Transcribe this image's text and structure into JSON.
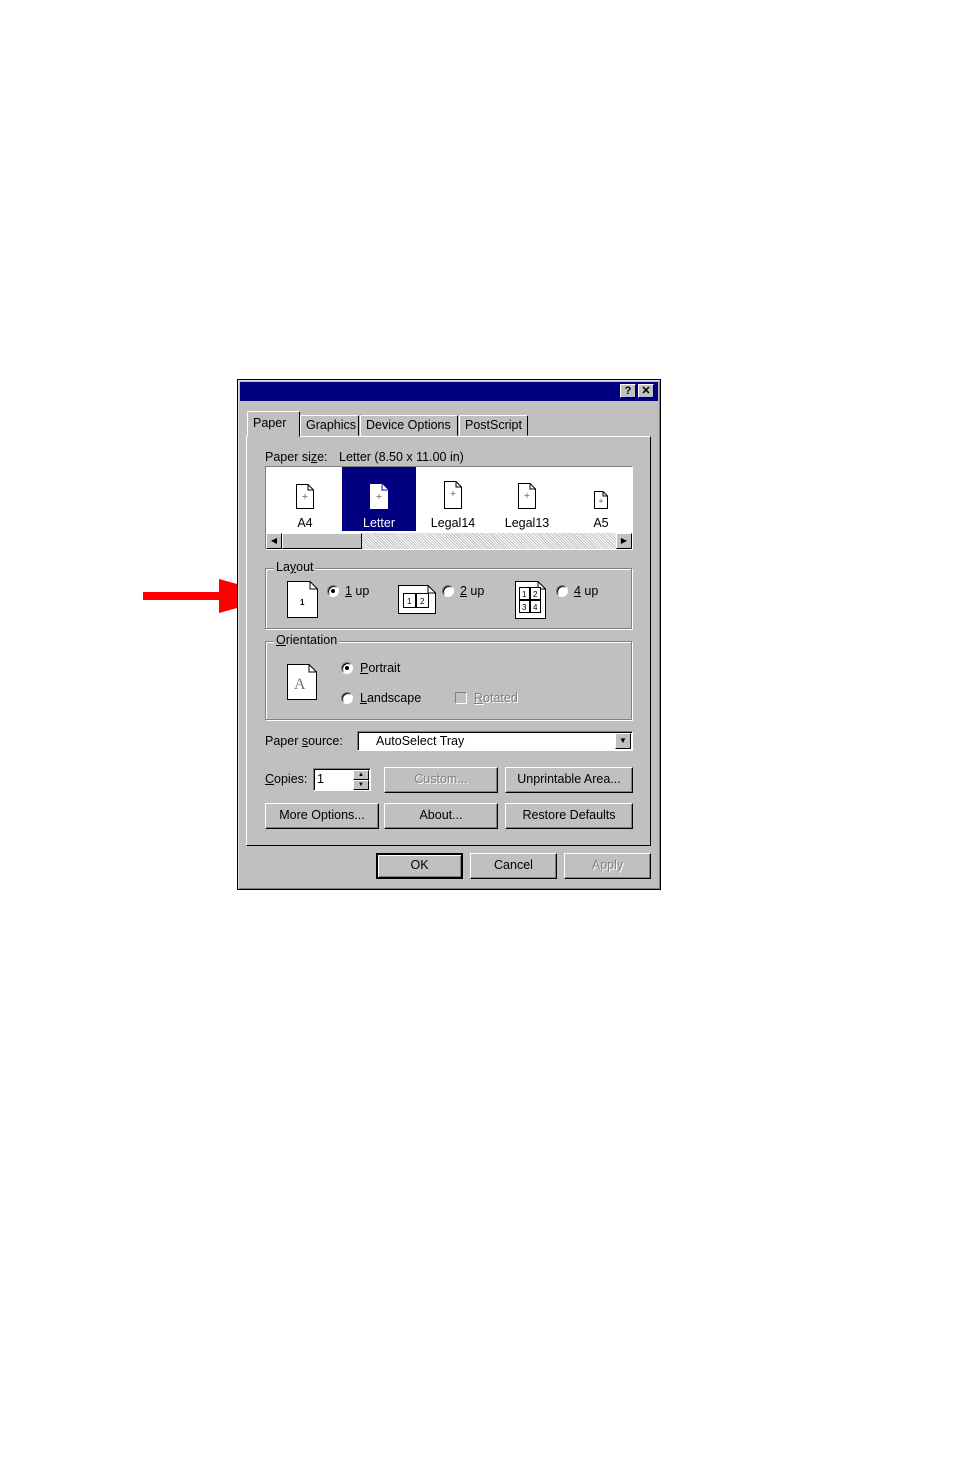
{
  "dialog": {
    "help_button": "?",
    "close_button": "✕",
    "tabs": [
      {
        "label": "Paper",
        "active": true
      },
      {
        "label": "Graphics",
        "active": false
      },
      {
        "label": "Device Options",
        "active": false
      },
      {
        "label": "PostScript",
        "active": false
      }
    ],
    "paper_size": {
      "label": "Paper size:",
      "value": "Letter (8.50 x 11.00 in)",
      "items": [
        "A4",
        "Letter",
        "Legal14",
        "Legal13",
        "A5"
      ],
      "selected": "Letter"
    },
    "layout": {
      "legend": "Layout",
      "options": [
        {
          "label": "1 up",
          "icon_text": "1",
          "selected": true
        },
        {
          "label": "2 up",
          "icon_text": "1 2",
          "selected": false
        },
        {
          "label": "4 up",
          "icon_text": "1 2 3 4",
          "selected": false
        }
      ]
    },
    "orientation": {
      "legend": "Orientation",
      "icon_letter": "A",
      "portrait": "Portrait",
      "landscape": "Landscape",
      "rotated": "Rotated",
      "selected": "Portrait"
    },
    "paper_source": {
      "label": "Paper source:",
      "value": "AutoSelect Tray"
    },
    "copies": {
      "label": "Copies:",
      "value": "1"
    },
    "buttons": {
      "custom": "Custom...",
      "unprintable_area": "Unprintable Area...",
      "more_options": "More Options...",
      "about": "About...",
      "restore_defaults": "Restore Defaults",
      "ok": "OK",
      "cancel": "Cancel",
      "apply": "Apply"
    }
  },
  "colors": {
    "title_bar": "#000080",
    "face": "#c0c0c0",
    "arrow": "#ff0000",
    "selection": "#000080"
  }
}
